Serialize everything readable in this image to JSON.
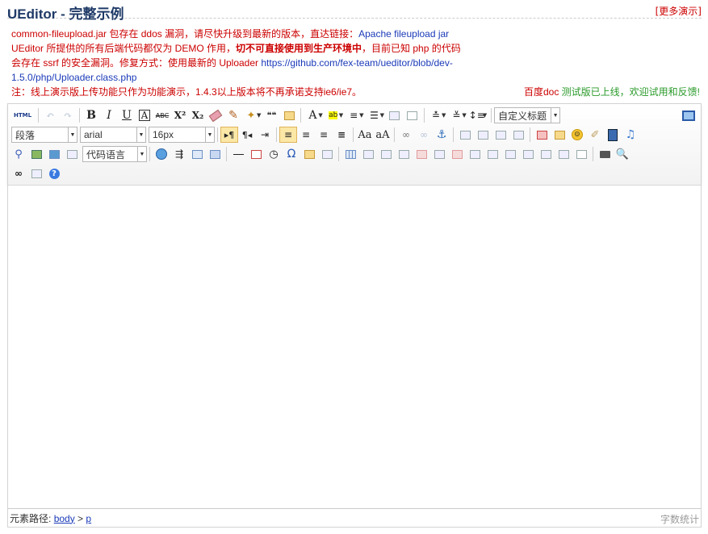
{
  "header": {
    "title": "UEditor - 完整示例",
    "more_link": "[更多演示]"
  },
  "notice": {
    "line1_a": "common-fileupload.jar 包存在 ddos 漏洞，请尽快升级到最新的版本，直达链接：",
    "line1_link": "Apache fileupload jar",
    "line2_a": "UEditor 所提供的所有后端代码都仅为 DEMO 作用，",
    "line2_bold": "切不可直接使用到生产环境中",
    "line2_b": "，目前已知 php 的代码会存在 ssrf 的安全漏洞。修复方式：使用最新的 Uploader ",
    "line2_link": "https://github.com/fex-team/ueditor/blob/dev-1.5.0/php/Uploader.class.php",
    "line3": "注：线上演示版上传功能只作为功能演示，1.4.3以上版本将不再承诺支持ie6/ie7。",
    "baidu_a": "百度doc",
    "baidu_b": " 测试版已上线，欢迎试用和反馈!"
  },
  "toolbar": {
    "html_label": "HTML",
    "bold": "B",
    "italic": "I",
    "underline": "U",
    "fontborder": "A",
    "strike": "ABC",
    "sup": "X²",
    "sub": "X₂",
    "font_color": "A",
    "custom_title": "自定义标题",
    "paragraph": "段落",
    "font_family": "arial",
    "font_size": "16px",
    "code_lang": "代码语言",
    "omega": "Ω",
    "quote": "❝❝"
  },
  "bottom": {
    "path_label": "元素路径:",
    "path_body": "body",
    "path_sep": " > ",
    "path_p": "p",
    "word_count": "字数统计"
  }
}
